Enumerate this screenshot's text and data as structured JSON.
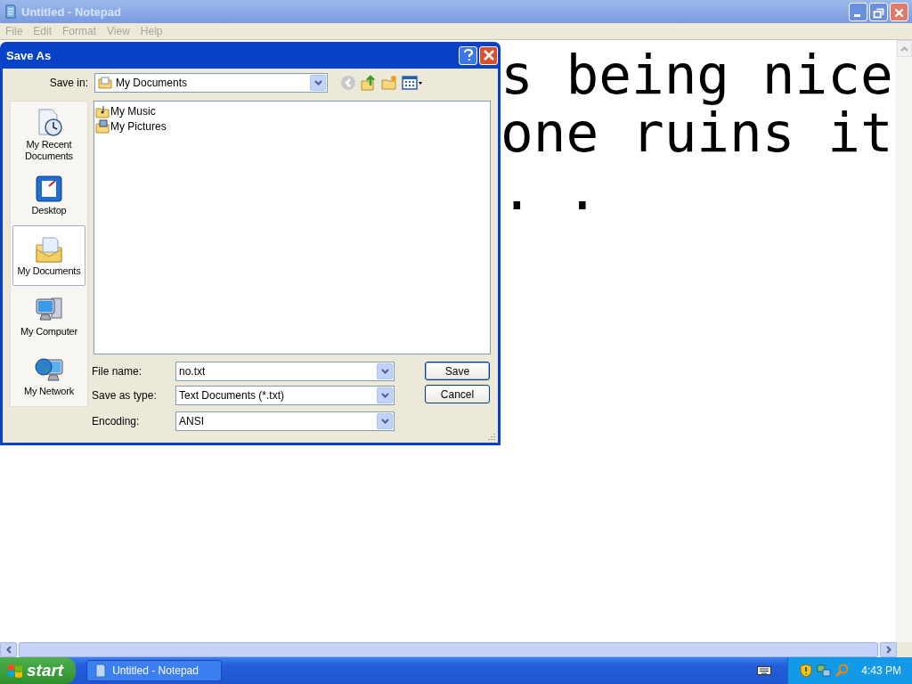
{
  "notepad": {
    "title": "Untitled - Notepad",
    "active": false,
    "menu": [
      {
        "label": "File",
        "disabled": true
      },
      {
        "label": "Edit",
        "disabled": true
      },
      {
        "label": "Format",
        "disabled": true
      },
      {
        "label": "View",
        "disabled": true
      },
      {
        "label": "Help",
        "disabled": true
      }
    ],
    "text_lines": [
      "s being nice",
      "one ruins it",
      ". ."
    ]
  },
  "dialog": {
    "title": "Save As",
    "save_in_label": "Save in:",
    "save_in_value": "My Documents",
    "places": [
      {
        "label": "My Recent Documents",
        "kind": "recent",
        "selected": false
      },
      {
        "label": "Desktop",
        "kind": "desktop",
        "selected": false
      },
      {
        "label": "My Documents",
        "kind": "documents",
        "selected": true
      },
      {
        "label": "My Computer",
        "kind": "computer",
        "selected": false
      },
      {
        "label": "My Network",
        "kind": "network",
        "selected": false
      }
    ],
    "files": [
      {
        "label": "My Music",
        "kind": "music"
      },
      {
        "label": "My Pictures",
        "kind": "pictures"
      }
    ],
    "fields": [
      {
        "label": "File name:",
        "value": "no.txt"
      },
      {
        "label": "Save as type:",
        "value": "Text Documents (*.txt)"
      },
      {
        "label": "Encoding:",
        "value": "ANSI"
      }
    ],
    "buttons": [
      {
        "label": "Save",
        "default": true
      },
      {
        "label": "Cancel",
        "default": false
      }
    ]
  },
  "taskbar": {
    "start": "start",
    "tasks": [
      {
        "label": "Untitled - Notepad"
      }
    ],
    "clock": "4:43 PM"
  }
}
